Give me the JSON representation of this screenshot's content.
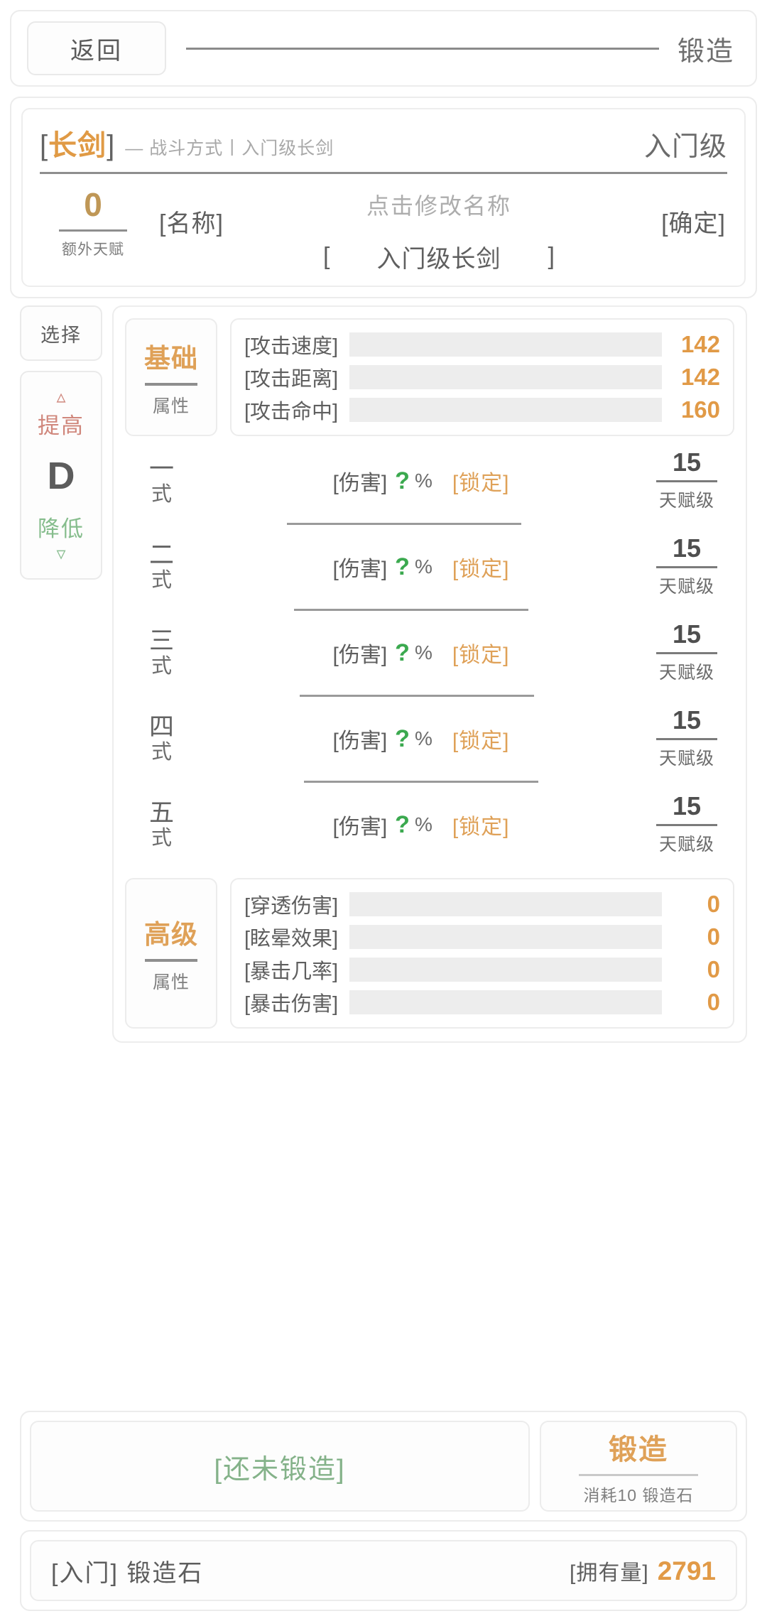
{
  "header": {
    "back_label": "返回",
    "title": "锻造"
  },
  "weapon": {
    "bracket_open": "[",
    "name": "长剑",
    "bracket_close": "]",
    "subtitle": "— 战斗方式丨入门级长剑",
    "grade": "入门级",
    "extra_talent_value": "0",
    "extra_talent_caption": "额外天赋",
    "name_field_label": "[名称]",
    "name_hint": "点击修改名称",
    "name_value_open": "[",
    "name_value": "入门级长剑",
    "name_value_close": "]",
    "confirm_label": "[确定]"
  },
  "sidebar": {
    "select_label": "选择",
    "raise_label": "提高",
    "raise_icon": "chevron-up-icon",
    "rank": "D",
    "lower_label": "降低",
    "lower_icon": "chevron-down-icon"
  },
  "basic_attributes": {
    "tag_main": "基础",
    "tag_sub": "属性",
    "rows": [
      {
        "name": "[攻击速度]",
        "value": "142"
      },
      {
        "name": "[攻击距离]",
        "value": "142"
      },
      {
        "name": "[攻击命中]",
        "value": "160"
      }
    ]
  },
  "skills": {
    "damage_label": "[伤害]",
    "unknown_mark": "?",
    "percent": "%",
    "lock_label": "[锁定]",
    "level_caption": "天赋级",
    "rows": [
      {
        "index_1": "一",
        "index_2": "式",
        "level": "15"
      },
      {
        "index_1": "二",
        "index_2": "式",
        "level": "15"
      },
      {
        "index_1": "三",
        "index_2": "式",
        "level": "15"
      },
      {
        "index_1": "四",
        "index_2": "式",
        "level": "15"
      },
      {
        "index_1": "五",
        "index_2": "式",
        "level": "15"
      }
    ]
  },
  "advanced_attributes": {
    "tag_main": "高级",
    "tag_sub": "属性",
    "rows": [
      {
        "name": "[穿透伤害]",
        "value": "0"
      },
      {
        "name": "[眩晕效果]",
        "value": "0"
      },
      {
        "name": "[暴击几率]",
        "value": "0"
      },
      {
        "name": "[暴击伤害]",
        "value": "0"
      }
    ]
  },
  "actions": {
    "status_label": "[还未锻造]",
    "forge_label": "锻造",
    "forge_cost": "消耗10 锻造石"
  },
  "stone": {
    "tier_label": "[入门] 锻造石",
    "have_label": "[拥有量]",
    "quantity": "2791"
  },
  "colors": {
    "accent_orange": "#dfa158",
    "accent_gold": "#bf9756",
    "success_green": "#84b289",
    "raise_red": "#d0877c",
    "lower_green": "#86bd8d",
    "text_gray": "#5e5e5e",
    "bar_track": "#ededed"
  }
}
